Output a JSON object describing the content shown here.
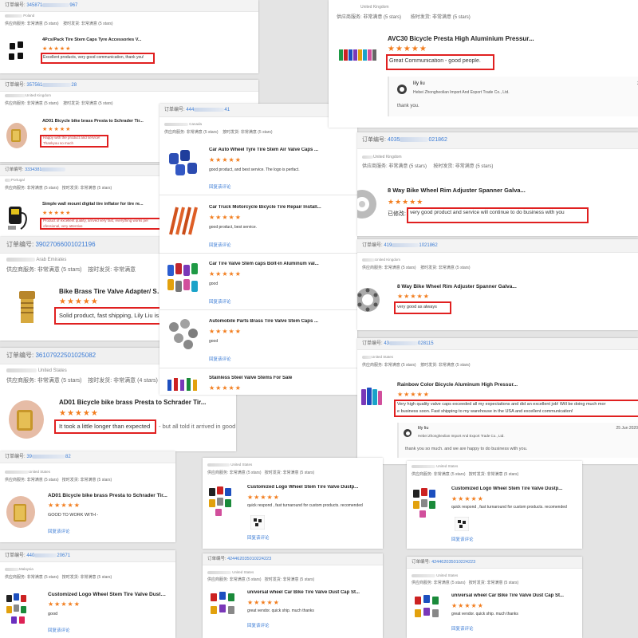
{
  "common": {
    "order_label": "订单编号:",
    "service_label": "供应商服务: 非常满意",
    "service_stars": "(5 stars)",
    "ship_label": "按时发货: 非常满意",
    "ship_stars": "(5 stars)",
    "ship_stars_4": "(4 stars)",
    "reply_link": "回复该评论",
    "rating_stars": "★★★★★",
    "edited_label": "已修改:"
  },
  "cards": {
    "c1": {
      "order_num": "345871",
      "order_num_tail": "967",
      "country": "Poland",
      "title": "4Pcs/Pack Tire Stem Caps Tyre Accessories V...",
      "comment": "Excellent products, very good communication, thank you!"
    },
    "c2": {
      "order_num": "357561",
      "order_num_tail": "28",
      "country": "United Kingdom",
      "title": "AD01 Bicycle bike brass Presta to Schrader Tir...",
      "comment_1": "Happy with the product and service!",
      "comment_2": "Thankyou so much"
    },
    "c3": {
      "order_num": "3334381",
      "country": "Portugal",
      "title": "Simple wall mount digital tire inflator for tire re...",
      "comment_1": "Product of excellent quality, arrived very fast, everything works per",
      "comment_2": "ofessional, very attentive"
    },
    "c4": {
      "order_num": "39027066001021196",
      "country": "Arab Emirates",
      "title": "Bike Brass Tire Valve Adapter/ Schr",
      "comment": "Solid product, fast shipping, Lily Liu is an"
    },
    "c5": {
      "order_num": "36107922501025082",
      "country": "United States",
      "title": "AD01 Bicycle bike brass Presta to Schrader Tir...",
      "comment": "It took a little longer than expected",
      "comment_rest": "- but all told it arrived in good time."
    },
    "c6": {
      "order_num": "39",
      "order_num_tail": "82",
      "country": "United States",
      "title": "AD01 Bicycle bike brass Presta to Schrader Tir...",
      "comment": "GOOD TO WORK WITH -"
    },
    "c7": {
      "order_num": "440",
      "order_num_tail": "20671",
      "country": "Malaysia",
      "title": "Customized Logo Wheel Stem Tire Valve Dustp...",
      "comment": "good"
    },
    "c8": {
      "order_num": "444",
      "order_num_tail": "41",
      "country": "Canada",
      "items": [
        {
          "title": "Car Auto Wheel Tyre Tire Stem Air Valve Caps ...",
          "comment": "good product, and best service. The logo is perfact."
        },
        {
          "title": "Car Truck Motorcycle Bicycle Tire Repair Install...",
          "comment": "good product, best service."
        },
        {
          "title": "Car Tire Valve Stem caps Bolt-in Aluminum val...",
          "comment": "good"
        },
        {
          "title": "Automobile Parts Brass Tire Valve Stem Caps ...",
          "comment": "good"
        },
        {
          "title": "Stainless Steel Valve Stems For Sale",
          "comment": ""
        }
      ]
    },
    "c9": {
      "country": "United Kingdom",
      "title": "AVC30 Bicycle Presta High Aluminium Pressur...",
      "comment": "Great Communication - good people.",
      "seller_name": "lily liu",
      "seller_company": "Hebei Zhongheolian Import And Export Trade Co., Ltd.",
      "seller_reply": "thank you.",
      "date_fragment": "2"
    },
    "c10": {
      "order_num": "4035",
      "order_num_tail": "021862",
      "country": "United Kingdom",
      "title": "8 Way Bike Wheel Rim Adjuster Spanner Galva...",
      "comment": "very good product and service will continue to do business with you"
    },
    "c11": {
      "order_num": "419",
      "order_num_tail": "1021862",
      "country": "United Kingdom",
      "title": "8 Way Bike Wheel Rim Adjuster Spanner Galva...",
      "comment": "very good as always"
    },
    "c12": {
      "order_num": "43",
      "order_num_tail": "028115",
      "country": "United States",
      "title": "Rainbow Color Bicycle Aluminum High Pressur...",
      "comment_1": "Very high quality valve caps exceeded all my expectations and did an excellent job! Will be doing much mor",
      "comment_2": "e business soon. Fast shipping to my warehouse in the USA and excellent communication!",
      "seller_name": "lily liu",
      "seller_company": "Hebei Zhongheolian Import And Export Trade Co., Ltd.",
      "seller_reply": "thank you so much. and we are happy to do business with you.",
      "date": "25 Jun 2020"
    },
    "c13": {
      "country": "United States",
      "title": "Customized Logo Wheel Stem Tire Valve Dustp...",
      "comment": "quick respond , fast turnaround for custom products. recomended"
    },
    "c14": {
      "country": "United States",
      "title": "Customized Logo Wheel Stem Tire Valve Dustp...",
      "comment": "quick respond , fast turnaround for custom products. recomended"
    },
    "c15": {
      "order_num": "424462035010224223",
      "country": "United States",
      "title": "universal wheel Car Bike Tire Valve Dust Cap St...",
      "comment": "great vendor. quick ship. much thanks"
    },
    "c16": {
      "order_num": "424462035010224223",
      "country": "United States",
      "title": "universal wheel Car Bike Tire Valve Dust Cap St...",
      "comment": "great vendor. quick ship. much thanks"
    }
  }
}
